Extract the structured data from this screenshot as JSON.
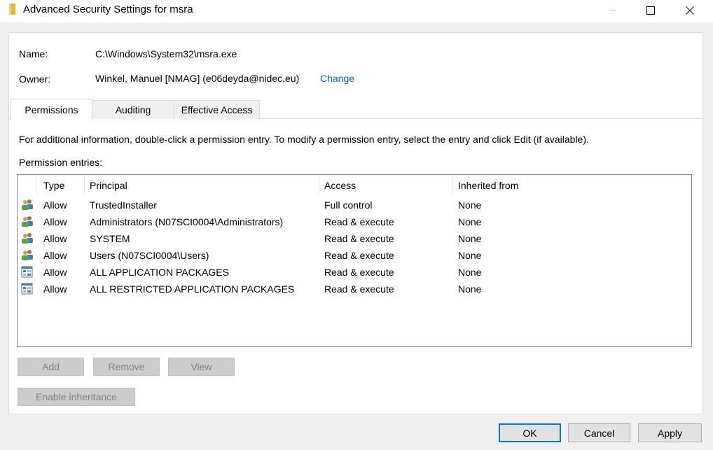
{
  "window": {
    "title": "Advanced Security Settings for msra"
  },
  "info": {
    "name_label": "Name:",
    "name_value": "C:\\Windows\\System32\\msra.exe",
    "owner_label": "Owner:",
    "owner_value": "Winkel, Manuel [NMAG] (e06deyda@nidec.eu)",
    "change_link": "Change"
  },
  "tabs": [
    {
      "label": "Permissions",
      "active": true
    },
    {
      "label": "Auditing",
      "active": false
    },
    {
      "label": "Effective Access",
      "active": false
    }
  ],
  "permissions": {
    "info_text": "For additional information, double-click a permission entry. To modify a permission entry, select the entry and click Edit (if available).",
    "entries_label": "Permission entries:",
    "columns": [
      "Type",
      "Principal",
      "Access",
      "Inherited from"
    ],
    "rows": [
      {
        "icon": "users-group-icon",
        "type": "Allow",
        "principal": "TrustedInstaller",
        "access": "Full control",
        "inherited": "None"
      },
      {
        "icon": "users-group-icon",
        "type": "Allow",
        "principal": "Administrators (N07SCI0004\\Administrators)",
        "access": "Read & execute",
        "inherited": "None"
      },
      {
        "icon": "users-group-icon",
        "type": "Allow",
        "principal": "SYSTEM",
        "access": "Read & execute",
        "inherited": "None"
      },
      {
        "icon": "users-group-icon",
        "type": "Allow",
        "principal": "Users (N07SCI0004\\Users)",
        "access": "Read & execute",
        "inherited": "None"
      },
      {
        "icon": "app-packages-icon",
        "type": "Allow",
        "principal": "ALL APPLICATION PACKAGES",
        "access": "Read & execute",
        "inherited": "None"
      },
      {
        "icon": "app-packages-icon",
        "type": "Allow",
        "principal": "ALL RESTRICTED APPLICATION PACKAGES",
        "access": "Read & execute",
        "inherited": "None"
      }
    ]
  },
  "buttons": {
    "add": "Add",
    "remove": "Remove",
    "view": "View",
    "enable_inheritance": "Enable inheritance",
    "ok": "OK",
    "cancel": "Cancel",
    "apply": "Apply"
  }
}
